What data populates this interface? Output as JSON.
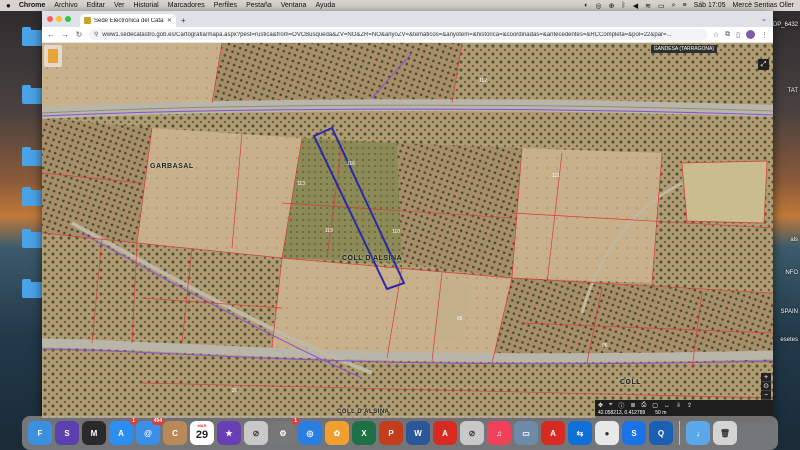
{
  "menubar": {
    "apple": "",
    "items": [
      "Chrome",
      "Archivo",
      "Editar",
      "Ver",
      "Historial",
      "Marcadores",
      "Perfiles",
      "Pestaña",
      "Ventana",
      "Ayuda"
    ],
    "datetime": "Sáb 17:05",
    "user": "Mercè Sentias Oller"
  },
  "browser": {
    "tab_title": "Sede Electrónica del Catastro",
    "url": "www1.sedecatastro.gob.es/Cartografia/mapa.aspx?pest=rustica&from=OVCBusqueda&ZV=NO&ZR=NO&anyoZV=&tematicos=&anyotem=&historica=&coordinadas=&antecedentes=&RCCompleta=&pol=22&par=..."
  },
  "map": {
    "top_badge": "GANDESA (TARRAGONA)",
    "labels": {
      "garbasal": "GARBASAL",
      "coll_alsina": "COLL D'ALSINA",
      "coll": "COLL",
      "coll_clalsina": "COLL D'ALSINA"
    },
    "parcel_numbers": [
      "112",
      "113",
      "115",
      "116",
      "118",
      "65",
      "96",
      "111",
      "26"
    ],
    "bottom_coords": "42.058213, 0.412789",
    "scale": "50 m"
  },
  "desktop": {
    "right_labels": [
      "DP_6432",
      "TAT",
      "als",
      "NFO",
      "SPAIN",
      "esetes"
    ]
  },
  "dock": {
    "apps": [
      {
        "name": "finder",
        "label": "F",
        "color": "#3d8fe0"
      },
      {
        "name": "siri",
        "label": "S",
        "color": "#5b3fae"
      },
      {
        "name": "mission-control",
        "label": "M",
        "color": "#2a2a2a"
      },
      {
        "name": "app-store",
        "label": "A",
        "color": "#2c8ef0",
        "badge": "1"
      },
      {
        "name": "mail",
        "label": "@",
        "color": "#3b8fe8",
        "badge": "494"
      },
      {
        "name": "contacts",
        "label": "C",
        "color": "#b88a5a"
      },
      {
        "name": "calendar",
        "label": "29",
        "color": "#ffffff",
        "month": "MAR"
      },
      {
        "name": "imovie",
        "label": "★",
        "color": "#6a3fb5"
      },
      {
        "name": "silenz",
        "label": "⊘",
        "color": "#c8c8c8"
      },
      {
        "name": "system-preferences",
        "label": "⚙",
        "color": "#777777",
        "badge": "1"
      },
      {
        "name": "safari",
        "label": "◎",
        "color": "#2a7de1"
      },
      {
        "name": "photos",
        "label": "✿",
        "color": "#f0a030"
      },
      {
        "name": "excel",
        "label": "X",
        "color": "#1e7145"
      },
      {
        "name": "powerpoint",
        "label": "P",
        "color": "#c43e1c"
      },
      {
        "name": "word",
        "label": "W",
        "color": "#2b579a"
      },
      {
        "name": "acrobat",
        "label": "A",
        "color": "#d72b22"
      },
      {
        "name": "silenz-2",
        "label": "⊘",
        "color": "#c8c8c8"
      },
      {
        "name": "music",
        "label": "♫",
        "color": "#f0405a"
      },
      {
        "name": "preview",
        "label": "▭",
        "color": "#6d8aa8"
      },
      {
        "name": "acrobat-reader",
        "label": "A",
        "color": "#d72b22"
      },
      {
        "name": "teamviewer",
        "label": "⇆",
        "color": "#0e6fd6"
      },
      {
        "name": "chrome",
        "label": "●",
        "color": "#e8e8e8"
      },
      {
        "name": "shazam",
        "label": "S",
        "color": "#1b73e8"
      },
      {
        "name": "quicktime",
        "label": "Q",
        "color": "#1a5fb4"
      },
      {
        "name": "downloads-folder",
        "label": "↓",
        "color": "#5aa8e8"
      },
      {
        "name": "trash",
        "label": "🗑",
        "color": "#d4d4d4"
      }
    ]
  },
  "colors": {
    "accent": "#1a73e8",
    "parcel_outline": "#d83a3a",
    "selected_parcel": "#2a2aa8",
    "road": "#b9b5a8"
  }
}
